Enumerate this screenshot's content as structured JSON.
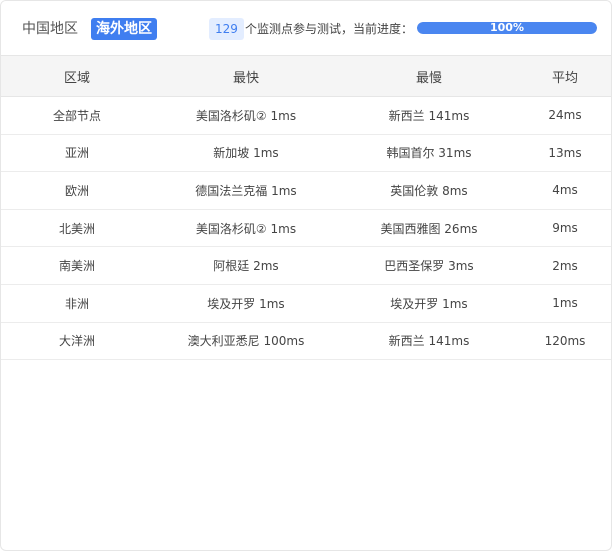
{
  "tabs": {
    "china": "中国地区",
    "overseas": "海外地区"
  },
  "monitor": {
    "count": "129",
    "text": "个监测点参与测试，当前进度：",
    "progress_label": "100%",
    "progress": 1.0
  },
  "table": {
    "headers": {
      "region": "区域",
      "fastest": "最快",
      "slowest": "最慢",
      "average": "平均"
    },
    "rows": [
      {
        "region": "全部节点",
        "fastest": "美国洛杉矶② 1ms",
        "slowest": "新西兰 141ms",
        "average": "24ms"
      },
      {
        "region": "亚洲",
        "fastest": "新加坡 1ms",
        "slowest": "韩国首尔 31ms",
        "average": "13ms"
      },
      {
        "region": "欧洲",
        "fastest": "德国法兰克福 1ms",
        "slowest": "英国伦敦 8ms",
        "average": "4ms"
      },
      {
        "region": "北美洲",
        "fastest": "美国洛杉矶② 1ms",
        "slowest": "美国西雅图 26ms",
        "average": "9ms"
      },
      {
        "region": "南美洲",
        "fastest": "阿根廷 2ms",
        "slowest": "巴西圣保罗 3ms",
        "average": "2ms"
      },
      {
        "region": "非洲",
        "fastest": "埃及开罗 1ms",
        "slowest": "埃及开罗 1ms",
        "average": "1ms"
      },
      {
        "region": "大洋洲",
        "fastest": "澳大利亚悉尼 100ms",
        "slowest": "新西兰 141ms",
        "average": "120ms"
      }
    ]
  },
  "colors": {
    "accent": "#3f7ef0",
    "progress": "#4a86f0",
    "header_bg": "#f5f5f5"
  }
}
